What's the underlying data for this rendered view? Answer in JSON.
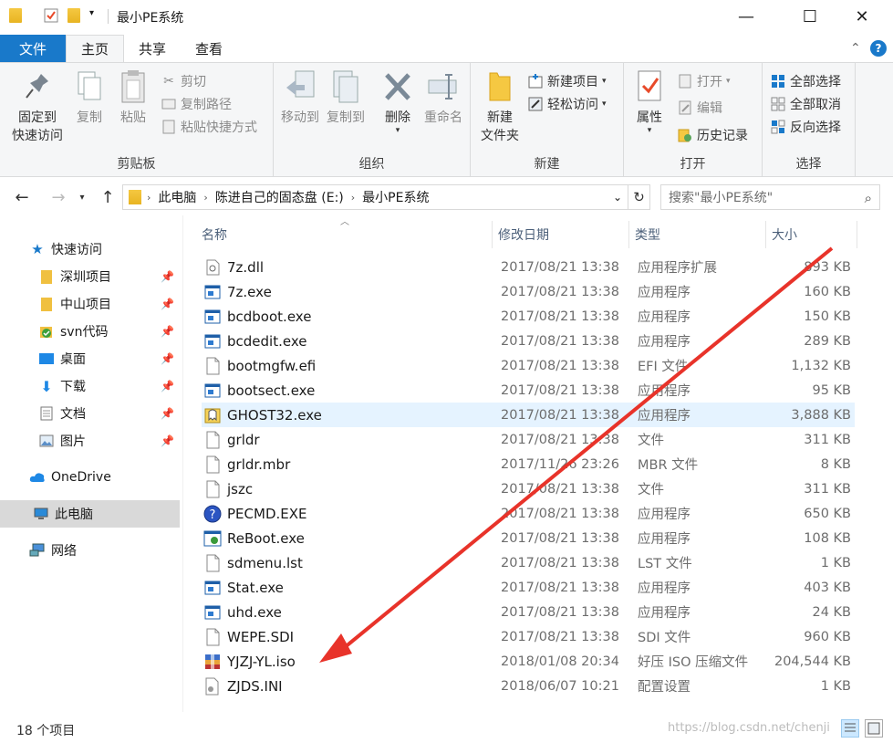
{
  "window": {
    "title": "最小PE系统",
    "minimize": "—",
    "maximize": "☐",
    "close": "✕"
  },
  "ribbon_tabs": {
    "file": "文件",
    "home": "主页",
    "share": "共享",
    "view": "查看"
  },
  "ribbon": {
    "clipboard": {
      "label": "剪贴板",
      "pin_quick_access_line1": "固定到",
      "pin_quick_access_line2": "快速访问",
      "copy": "复制",
      "paste": "粘贴",
      "cut": "剪切",
      "copy_path": "复制路径",
      "paste_shortcut": "粘贴快捷方式"
    },
    "organize": {
      "label": "组织",
      "move_to": "移动到",
      "copy_to": "复制到",
      "delete": "删除",
      "rename": "重命名"
    },
    "new": {
      "label": "新建",
      "new_folder_line1": "新建",
      "new_folder_line2": "文件夹",
      "new_item": "新建项目",
      "easy_access": "轻松访问"
    },
    "open": {
      "label": "打开",
      "properties": "属性",
      "open": "打开",
      "edit": "编辑",
      "history": "历史记录"
    },
    "select": {
      "label": "选择",
      "select_all": "全部选择",
      "select_none": "全部取消",
      "invert": "反向选择"
    }
  },
  "address": {
    "crumbs": [
      "此电脑",
      "陈进自己的固态盘 (E:)",
      "最小PE系统"
    ],
    "search_placeholder": "搜索\"最小PE系统\""
  },
  "nav": {
    "quick_access": "快速访问",
    "items": [
      {
        "label": "深圳项目",
        "pinned": true
      },
      {
        "label": "中山项目",
        "pinned": true
      },
      {
        "label": "svn代码",
        "pinned": true
      },
      {
        "label": "桌面",
        "pinned": true
      },
      {
        "label": "下载",
        "pinned": true
      },
      {
        "label": "文档",
        "pinned": true
      },
      {
        "label": "图片",
        "pinned": true
      }
    ],
    "onedrive": "OneDrive",
    "this_pc": "此电脑",
    "network": "网络"
  },
  "columns": {
    "name": "名称",
    "date": "修改日期",
    "type": "类型",
    "size": "大小"
  },
  "files": [
    {
      "name": "7z.dll",
      "date": "2017/08/21 13:38",
      "type": "应用程序扩展",
      "size": "893 KB",
      "icon": "dll"
    },
    {
      "name": "7z.exe",
      "date": "2017/08/21 13:38",
      "type": "应用程序",
      "size": "160 KB",
      "icon": "exe"
    },
    {
      "name": "bcdboot.exe",
      "date": "2017/08/21 13:38",
      "type": "应用程序",
      "size": "150 KB",
      "icon": "exe"
    },
    {
      "name": "bcdedit.exe",
      "date": "2017/08/21 13:38",
      "type": "应用程序",
      "size": "289 KB",
      "icon": "exe"
    },
    {
      "name": "bootmgfw.efi",
      "date": "2017/08/21 13:38",
      "type": "EFI 文件",
      "size": "1,132 KB",
      "icon": "file"
    },
    {
      "name": "bootsect.exe",
      "date": "2017/08/21 13:38",
      "type": "应用程序",
      "size": "95 KB",
      "icon": "exe"
    },
    {
      "name": "GHOST32.exe",
      "date": "2017/08/21 13:38",
      "type": "应用程序",
      "size": "3,888 KB",
      "icon": "ghost"
    },
    {
      "name": "grldr",
      "date": "2017/08/21 13:38",
      "type": "文件",
      "size": "311 KB",
      "icon": "file"
    },
    {
      "name": "grldr.mbr",
      "date": "2017/11/26 23:26",
      "type": "MBR 文件",
      "size": "8 KB",
      "icon": "file"
    },
    {
      "name": "jszc",
      "date": "2017/08/21 13:38",
      "type": "文件",
      "size": "311 KB",
      "icon": "file"
    },
    {
      "name": "PECMD.EXE",
      "date": "2017/08/21 13:38",
      "type": "应用程序",
      "size": "650 KB",
      "icon": "pecmd"
    },
    {
      "name": "ReBoot.exe",
      "date": "2017/08/21 13:38",
      "type": "应用程序",
      "size": "108 KB",
      "icon": "reboot"
    },
    {
      "name": "sdmenu.lst",
      "date": "2017/08/21 13:38",
      "type": "LST 文件",
      "size": "1 KB",
      "icon": "file"
    },
    {
      "name": "Stat.exe",
      "date": "2017/08/21 13:38",
      "type": "应用程序",
      "size": "403 KB",
      "icon": "exe"
    },
    {
      "name": "uhd.exe",
      "date": "2017/08/21 13:38",
      "type": "应用程序",
      "size": "24 KB",
      "icon": "exe"
    },
    {
      "name": "WEPE.SDI",
      "date": "2017/08/21 13:38",
      "type": "SDI 文件",
      "size": "960 KB",
      "icon": "file"
    },
    {
      "name": "YJZJ-YL.iso",
      "date": "2018/01/08 20:34",
      "type": "好压 ISO 压缩文件",
      "size": "204,544 KB",
      "icon": "iso"
    },
    {
      "name": "ZJDS.INI",
      "date": "2018/06/07 10:21",
      "type": "配置设置",
      "size": "1 KB",
      "icon": "ini"
    }
  ],
  "hover_row_index": 6,
  "status": {
    "count": "18 个项目",
    "watermark": "https://blog.csdn.net/chenji"
  },
  "colors": {
    "file_tab": "#1979ca",
    "hover_row": "#e5f3ff",
    "arrow": "#e8332a"
  }
}
